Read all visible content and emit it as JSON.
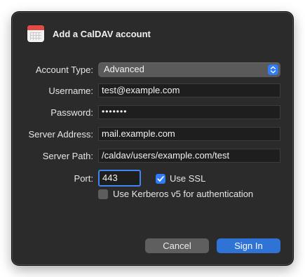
{
  "dialog": {
    "title": "Add a CalDAV account",
    "icon": "calendar-icon"
  },
  "form": {
    "account_type": {
      "label": "Account Type:",
      "value": "Advanced"
    },
    "username": {
      "label": "Username:",
      "value": "test@example.com"
    },
    "password": {
      "label": "Password:",
      "value": "•••••••"
    },
    "server_address": {
      "label": "Server Address:",
      "value": "mail.example.com"
    },
    "server_path": {
      "label": "Server Path:",
      "value": "/caldav/users/example.com/test"
    },
    "port": {
      "label": "Port:",
      "value": "443"
    },
    "use_ssl": {
      "label": "Use SSL",
      "checked": true
    },
    "use_kerberos": {
      "label": "Use Kerberos v5 for authentication",
      "checked": false
    }
  },
  "buttons": {
    "cancel_label": "Cancel",
    "signin_label": "Sign In"
  },
  "colors": {
    "accent": "#2f7cf6",
    "dialog_bg": "#2b2b2b"
  }
}
